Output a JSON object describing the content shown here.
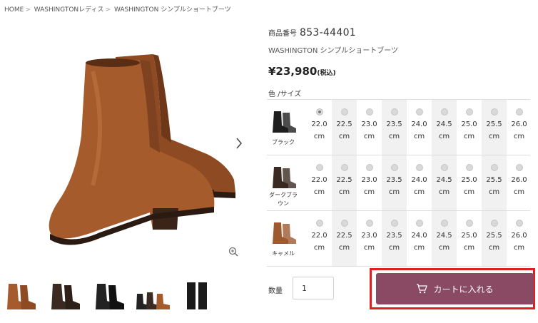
{
  "breadcrumb": {
    "items": [
      "HOME",
      "WASHINGTONレディス",
      "WASHINGTON シンプルショートブーツ"
    ],
    "separator": ">"
  },
  "product": {
    "code_label": "商品番号",
    "code": "853-44401",
    "name": "WASHINGTON シンプルショートブーツ",
    "price": "¥23,980",
    "tax_note": "(税込)"
  },
  "variant_label": "色 /サイズ",
  "sizes": [
    "22.0",
    "22.5",
    "23.0",
    "23.5",
    "24.0",
    "24.5",
    "25.0",
    "25.5",
    "26.0"
  ],
  "size_unit": "cm",
  "colors": [
    {
      "name_lines": [
        "ブラック"
      ],
      "swatch": "#1e1e1e",
      "selected_size_index": 0
    },
    {
      "name_lines": [
        "ダークブラ",
        "ウン"
      ],
      "swatch": "#3a2a22",
      "selected_size_index": null
    },
    {
      "name_lines": [
        "キャメル"
      ],
      "swatch": "#9c5a2e",
      "selected_size_index": null
    }
  ],
  "quantity": {
    "label": "数量",
    "value": "1"
  },
  "cart_button": {
    "label": "カートに入れる",
    "color": "#8a4a63"
  },
  "colors_theme": {
    "highlight_outline": "#e02020",
    "boot_brown": "#a0582b"
  },
  "icons": {
    "next": "chevron-right-icon",
    "zoom": "zoom-in-icon",
    "cart": "cart-icon"
  }
}
